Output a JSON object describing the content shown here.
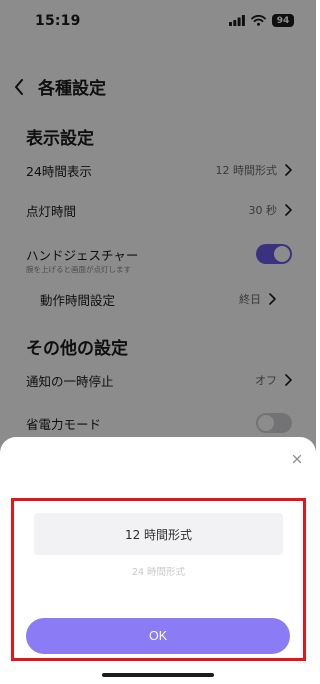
{
  "status": {
    "time": "15:19",
    "battery": "94"
  },
  "header": {
    "title": "各種設定"
  },
  "display_section": {
    "title": "表示設定",
    "rows": [
      {
        "label": "24時間表示",
        "value": "12 時間形式"
      },
      {
        "label": "点灯時間",
        "value": "30 秒"
      },
      {
        "label": "ハンドジェスチャー",
        "sub": "腕を上げると画面が点灯します",
        "toggle": "on"
      },
      {
        "label": "動作時間設定",
        "value": "終日"
      }
    ]
  },
  "other_section": {
    "title": "その他の設定",
    "rows": [
      {
        "label": "通知の一時停止",
        "value": "オフ"
      },
      {
        "label": "省電力モード",
        "toggle": "off"
      }
    ]
  },
  "sheet": {
    "options": [
      "12 時間形式",
      "24 時間形式"
    ],
    "selected": "12 時間形式",
    "ok_label": "OK"
  },
  "colors": {
    "accent": "#8b7cf6",
    "toggle_on": "#6c5ce7",
    "highlight": "#e8141c"
  }
}
